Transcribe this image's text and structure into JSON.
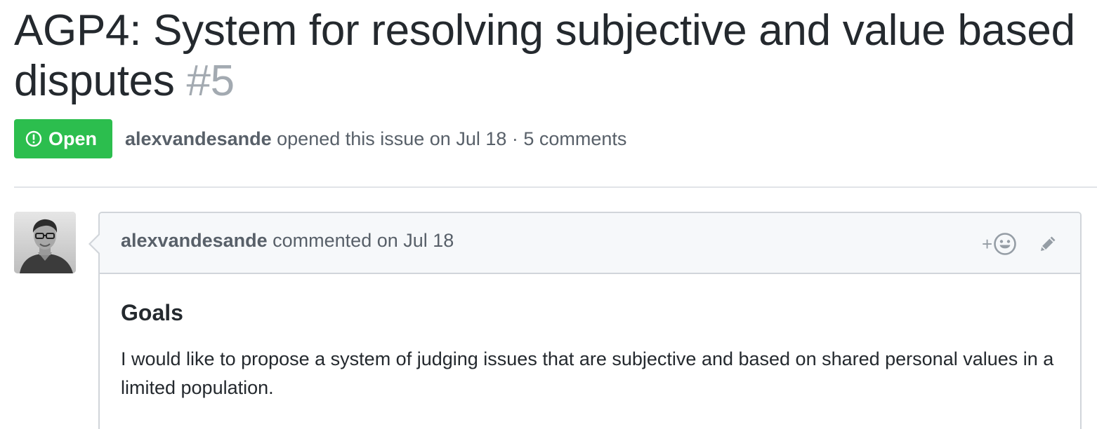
{
  "issue": {
    "title": "AGP4: System for resolving subjective and value based disputes",
    "number": "#5",
    "state": "Open",
    "state_icon": "issue-opened-icon",
    "author": "alexvandesande",
    "opened_text": "opened this issue on Jul 18 · 5 comments",
    "colors": {
      "open_badge": "#2cbe4e",
      "muted_text": "#586069",
      "issue_number": "#a3aab1"
    }
  },
  "comment": {
    "author": "alexvandesande",
    "action_text": "commented on Jul 18",
    "reaction_icon": "add-reaction-icon",
    "reaction_plus": "+",
    "edit_icon": "pencil-icon",
    "body": {
      "heading": "Goals",
      "paragraph": "I would like to propose a system of judging issues that are subjective and based on shared personal values in a limited population."
    }
  }
}
